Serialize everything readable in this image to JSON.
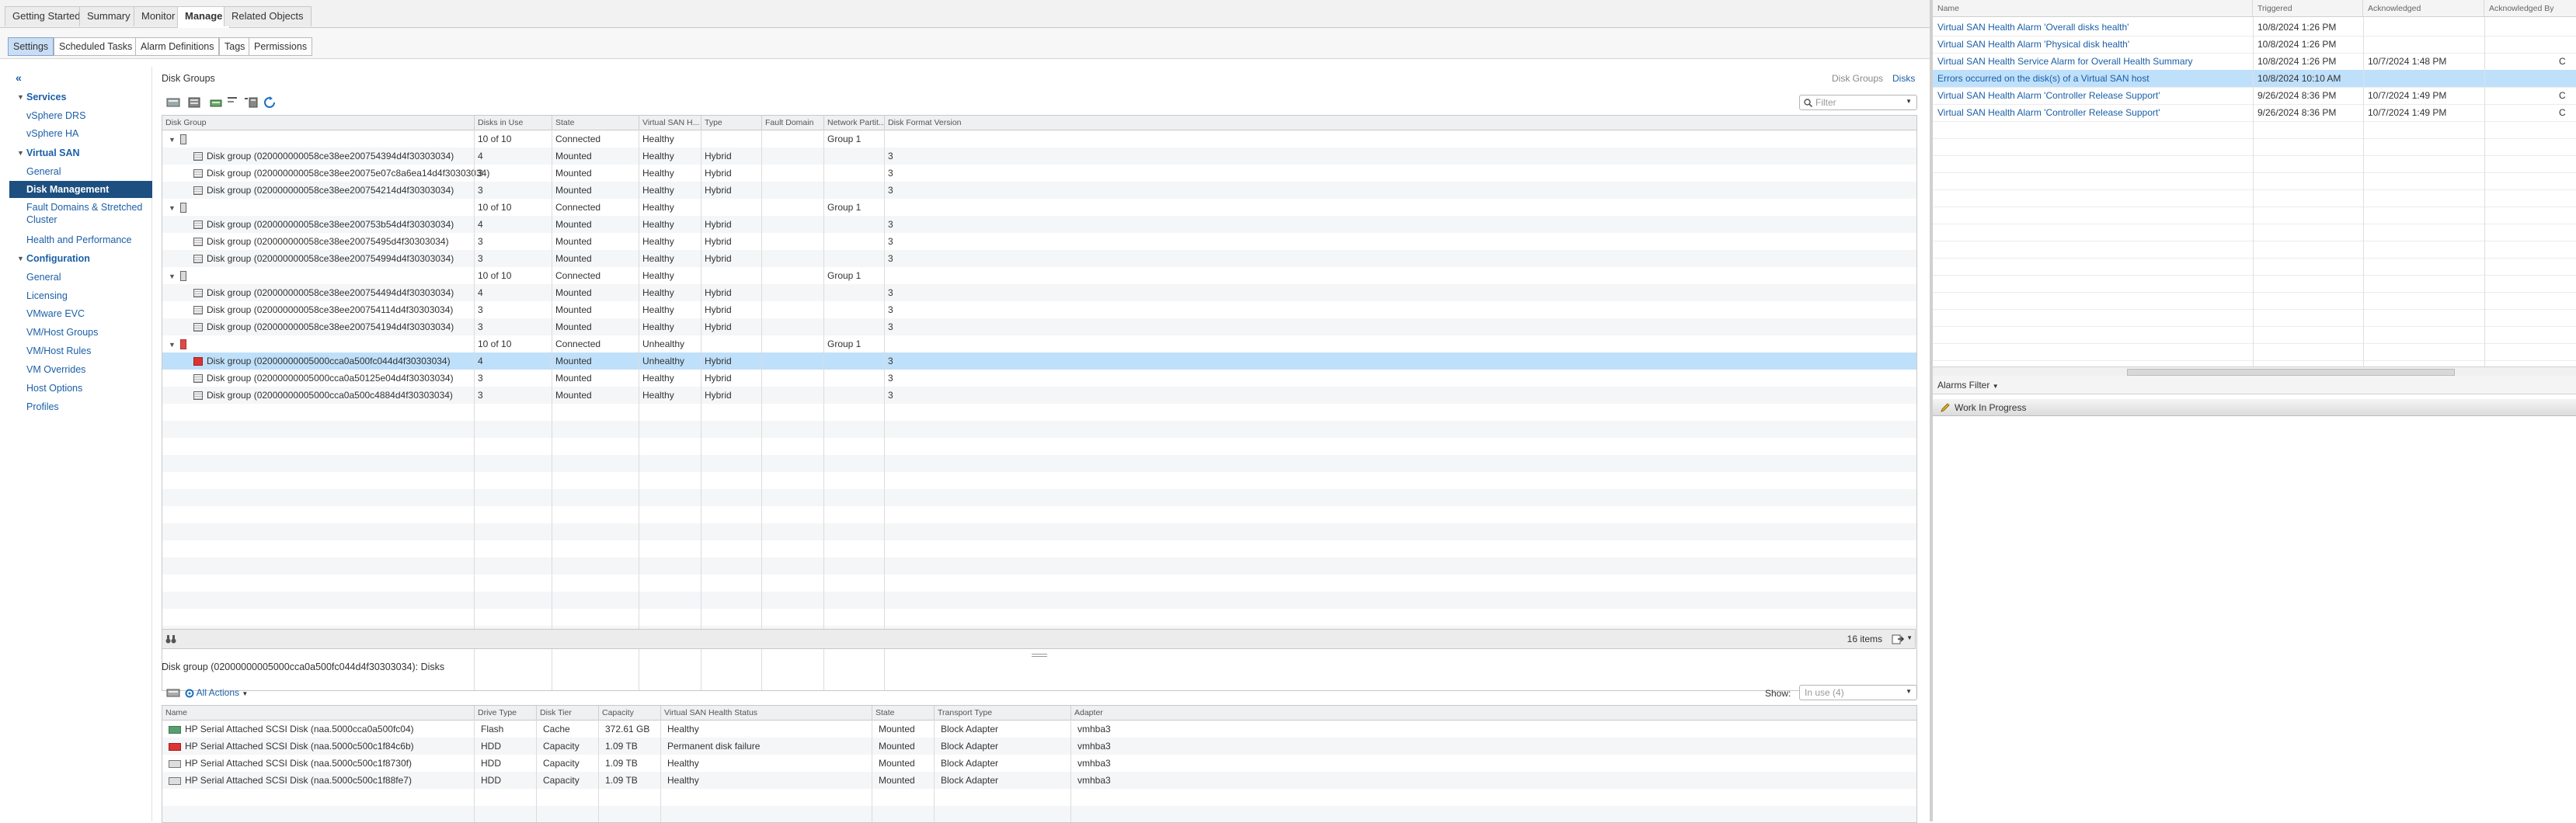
{
  "tabs": [
    "Getting Started",
    "Summary",
    "Monitor",
    "Manage",
    "Related Objects"
  ],
  "active_tab": "Manage",
  "subtabs": [
    "Settings",
    "Scheduled Tasks",
    "Alarm Definitions",
    "Tags",
    "Permissions"
  ],
  "active_subtab": "Settings",
  "nav": {
    "collapse": "«",
    "services": "Services",
    "vsphere_drs": "vSphere DRS",
    "vsphere_ha": "vSphere HA",
    "virtual_san": "Virtual SAN",
    "general": "General",
    "disk_management": "Disk Management",
    "fault_domains": "Fault Domains & Stretched Cluster",
    "health": "Health and Performance",
    "configuration": "Configuration",
    "config_general": "General",
    "licensing": "Licensing",
    "vmware_evc": "VMware EVC",
    "vm_host_groups": "VM/Host Groups",
    "vm_host_rules": "VM/Host Rules",
    "vm_overrides": "VM Overrides",
    "host_options": "Host Options",
    "profiles": "Profiles"
  },
  "disk_groups": {
    "title": "Disk Groups",
    "view_disk_groups": "Disk Groups",
    "view_disks": "Disks",
    "filter_placeholder": "Filter",
    "columns": [
      "Disk Group",
      "Disks in Use",
      "State",
      "Virtual SAN H...",
      "Type",
      "Fault Domain",
      "Network Partit...",
      "Disk Format Version"
    ],
    "rows": [
      {
        "kind": "host",
        "name": "",
        "disks": "10 of 10",
        "state": "Connected",
        "health": "Healthy",
        "type": "",
        "fault": "",
        "partition": "Group 1",
        "version": ""
      },
      {
        "kind": "dg",
        "name": "Disk group (020000000058ce38ee200754394d4f30303034)",
        "disks": "4",
        "state": "Mounted",
        "health": "Healthy",
        "type": "Hybrid",
        "fault": "",
        "partition": "",
        "version": "3"
      },
      {
        "kind": "dg",
        "name": "Disk group (020000000058ce38ee20075e07c8a6ea14d4f30303034)",
        "disks": "3",
        "state": "Mounted",
        "health": "Healthy",
        "type": "Hybrid",
        "fault": "",
        "partition": "",
        "version": "3"
      },
      {
        "kind": "dg",
        "name": "Disk group (020000000058ce38ee200754214d4f30303034)",
        "disks": "3",
        "state": "Mounted",
        "health": "Healthy",
        "type": "Hybrid",
        "fault": "",
        "partition": "",
        "version": "3"
      },
      {
        "kind": "host",
        "name": "",
        "disks": "10 of 10",
        "state": "Connected",
        "health": "Healthy",
        "type": "",
        "fault": "",
        "partition": "Group 1",
        "version": ""
      },
      {
        "kind": "dg",
        "name": "Disk group (020000000058ce38ee200753b54d4f30303034)",
        "disks": "4",
        "state": "Mounted",
        "health": "Healthy",
        "type": "Hybrid",
        "fault": "",
        "partition": "",
        "version": "3"
      },
      {
        "kind": "dg",
        "name": "Disk group (020000000058ce38ee20075495d4f30303034)",
        "disks": "3",
        "state": "Mounted",
        "health": "Healthy",
        "type": "Hybrid",
        "fault": "",
        "partition": "",
        "version": "3"
      },
      {
        "kind": "dg",
        "name": "Disk group (020000000058ce38ee200754994d4f30303034)",
        "disks": "3",
        "state": "Mounted",
        "health": "Healthy",
        "type": "Hybrid",
        "fault": "",
        "partition": "",
        "version": "3"
      },
      {
        "kind": "host",
        "name": "",
        "disks": "10 of 10",
        "state": "Connected",
        "health": "Healthy",
        "type": "",
        "fault": "",
        "partition": "Group 1",
        "version": ""
      },
      {
        "kind": "dg",
        "name": "Disk group (020000000058ce38ee200754494d4f30303034)",
        "disks": "4",
        "state": "Mounted",
        "health": "Healthy",
        "type": "Hybrid",
        "fault": "",
        "partition": "",
        "version": "3"
      },
      {
        "kind": "dg",
        "name": "Disk group (020000000058ce38ee200754114d4f30303034)",
        "disks": "3",
        "state": "Mounted",
        "health": "Healthy",
        "type": "Hybrid",
        "fault": "",
        "partition": "",
        "version": "3"
      },
      {
        "kind": "dg",
        "name": "Disk group (020000000058ce38ee200754194d4f30303034)",
        "disks": "3",
        "state": "Mounted",
        "health": "Healthy",
        "type": "Hybrid",
        "fault": "",
        "partition": "",
        "version": "3"
      },
      {
        "kind": "hosterr",
        "name": "",
        "disks": "10 of 10",
        "state": "Connected",
        "health": "Unhealthy",
        "type": "",
        "fault": "",
        "partition": "Group 1",
        "version": ""
      },
      {
        "kind": "dgerr",
        "name": "Disk group (02000000005000cca0a500fc044d4f30303034)",
        "disks": "4",
        "state": "Mounted",
        "health": "Unhealthy",
        "type": "Hybrid",
        "fault": "",
        "partition": "",
        "version": "3",
        "selected": true
      },
      {
        "kind": "dg",
        "name": "Disk group (02000000005000cca0a50125e04d4f30303034)",
        "disks": "3",
        "state": "Mounted",
        "health": "Healthy",
        "type": "Hybrid",
        "fault": "",
        "partition": "",
        "version": "3"
      },
      {
        "kind": "dg",
        "name": "Disk group (02000000005000cca0a500c4884d4f30303034)",
        "disks": "3",
        "state": "Mounted",
        "health": "Healthy",
        "type": "Hybrid",
        "fault": "",
        "partition": "",
        "version": "3"
      }
    ],
    "item_count": "16 items"
  },
  "disks": {
    "title": "Disk group (02000000005000cca0a500fc044d4f30303034): Disks",
    "all_actions": "All Actions",
    "show_label": "Show:",
    "show_value": "In use (4)",
    "columns": [
      "Name",
      "Drive Type",
      "Disk Tier",
      "Capacity",
      "Virtual SAN Health Status",
      "State",
      "Transport Type",
      "Adapter"
    ],
    "rows": [
      {
        "icon": "flash",
        "name": "HP Serial Attached SCSI Disk (naa.5000cca0a500fc04)",
        "drive": "Flash",
        "tier": "Cache",
        "capacity": "372.61 GB",
        "health": "Healthy",
        "state": "Mounted",
        "transport": "Block Adapter",
        "adapter": "vmhba3"
      },
      {
        "icon": "err",
        "name": "HP Serial Attached SCSI Disk (naa.5000c500c1f84c6b)",
        "drive": "HDD",
        "tier": "Capacity",
        "capacity": "1.09 TB",
        "health": "Permanent disk failure",
        "state": "Mounted",
        "transport": "Block Adapter",
        "adapter": "vmhba3"
      },
      {
        "icon": "hdd",
        "name": "HP Serial Attached SCSI Disk (naa.5000c500c1f8730f)",
        "drive": "HDD",
        "tier": "Capacity",
        "capacity": "1.09 TB",
        "health": "Healthy",
        "state": "Mounted",
        "transport": "Block Adapter",
        "adapter": "vmhba3"
      },
      {
        "icon": "hdd",
        "name": "HP Serial Attached SCSI Disk (naa.5000c500c1f88fe7)",
        "drive": "HDD",
        "tier": "Capacity",
        "capacity": "1.09 TB",
        "health": "Healthy",
        "state": "Mounted",
        "transport": "Block Adapter",
        "adapter": "vmhba3"
      }
    ]
  },
  "alarms": {
    "columns": [
      "Name",
      "Triggered",
      "Acknowledged",
      "Acknowledged By"
    ],
    "rows": [
      {
        "name": "Virtual SAN Health Alarm 'Overall disks health'",
        "triggered": "10/8/2024 1:26 PM",
        "ack": "",
        "ackby": ""
      },
      {
        "name": "Virtual SAN Health Alarm 'Physical disk health'",
        "triggered": "10/8/2024 1:26 PM",
        "ack": "",
        "ackby": ""
      },
      {
        "name": "Virtual SAN Health Service Alarm for Overall Health Summary",
        "triggered": "10/8/2024 1:26 PM",
        "ack": "10/7/2024 1:48 PM",
        "ackby": "C"
      },
      {
        "name": "Errors occurred on the disk(s) of a Virtual SAN host",
        "triggered": "10/8/2024 10:10 AM",
        "ack": "",
        "ackby": "",
        "selected": true
      },
      {
        "name": "Virtual SAN Health Alarm 'Controller Release Support'",
        "triggered": "9/26/2024 8:36 PM",
        "ack": "10/7/2024 1:49 PM",
        "ackby": "C"
      },
      {
        "name": "Virtual SAN Health Alarm 'Controller Release Support'",
        "triggered": "9/26/2024 8:36 PM",
        "ack": "10/7/2024 1:49 PM",
        "ackby": "C"
      }
    ],
    "filter_label": "Alarms Filter",
    "work_in_progress": "Work In Progress"
  }
}
